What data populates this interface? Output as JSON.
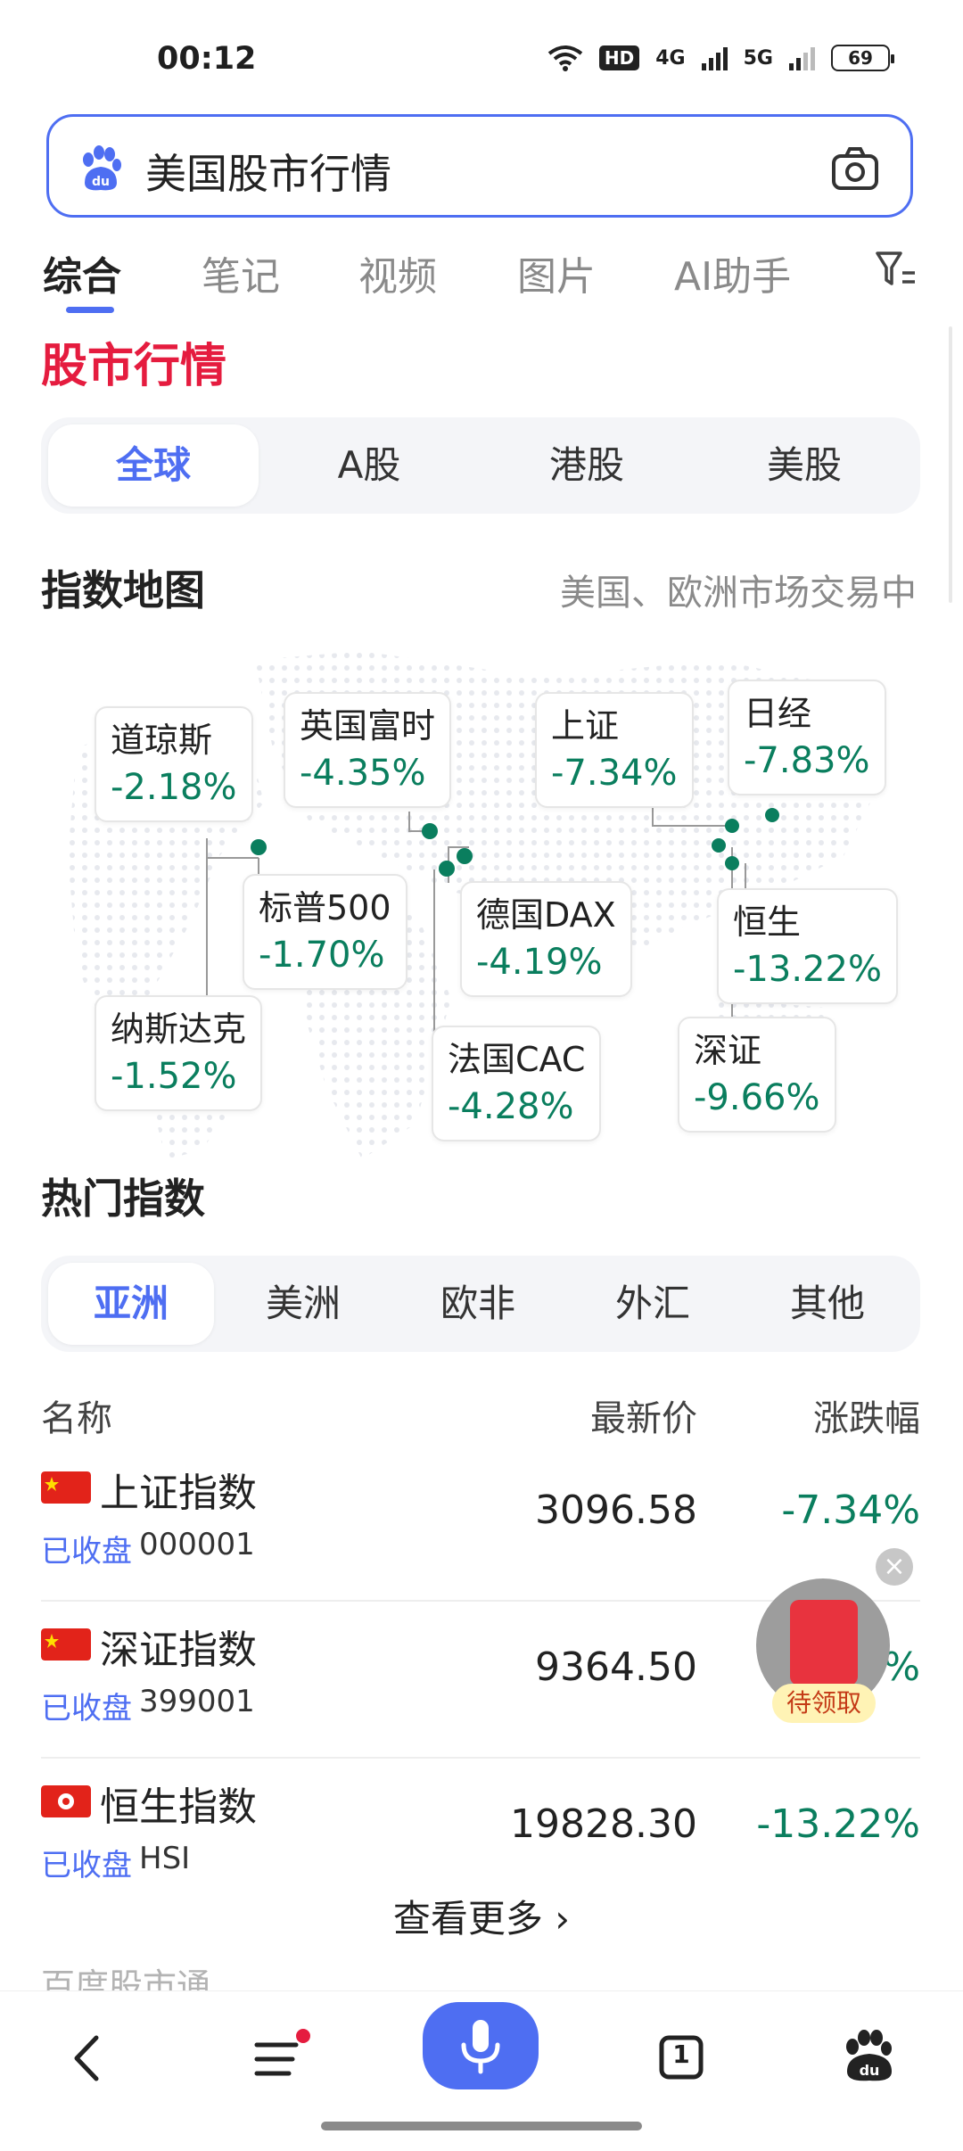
{
  "status": {
    "time": "00:12",
    "battery": "69",
    "hd": "HD",
    "net1": "4G",
    "net2": "5G"
  },
  "search": {
    "query": "美国股市行情",
    "camera_icon": "camera-icon",
    "logo_icon": "baidu-paw-icon"
  },
  "tabs": [
    {
      "label": "综合"
    },
    {
      "label": "笔记"
    },
    {
      "label": "视频"
    },
    {
      "label": "图片"
    },
    {
      "label": "AI助手"
    }
  ],
  "section_title": "股市行情",
  "market_tabs": [
    {
      "label": "全球"
    },
    {
      "label": "A股"
    },
    {
      "label": "港股"
    },
    {
      "label": "美股"
    }
  ],
  "index_map": {
    "title": "指数地图",
    "status": "美国、欧洲市场交易中",
    "indices": [
      {
        "name": "道琼斯",
        "change": "-2.18%"
      },
      {
        "name": "英国富时",
        "change": "-4.35%"
      },
      {
        "name": "上证",
        "change": "-7.34%"
      },
      {
        "name": "日经",
        "change": "-7.83%"
      },
      {
        "name": "标普500",
        "change": "-1.70%"
      },
      {
        "name": "德国DAX",
        "change": "-4.19%"
      },
      {
        "name": "恒生",
        "change": "-13.22%"
      },
      {
        "name": "纳斯达克",
        "change": "-1.52%"
      },
      {
        "name": "法国CAC",
        "change": "-4.28%"
      },
      {
        "name": "深证",
        "change": "-9.66%"
      }
    ]
  },
  "hot_indices": {
    "title": "热门指数",
    "tabs": [
      {
        "label": "亚洲"
      },
      {
        "label": "美洲"
      },
      {
        "label": "欧非"
      },
      {
        "label": "外汇"
      },
      {
        "label": "其他"
      }
    ],
    "columns": {
      "name": "名称",
      "price": "最新价",
      "change": "涨跌幅"
    },
    "rows": [
      {
        "name": "上证指数",
        "status": "已收盘",
        "code": "000001",
        "price": "3096.58",
        "change": "-7.34%"
      },
      {
        "name": "深证指数",
        "status": "已收盘",
        "code": "399001",
        "price": "9364.50",
        "change": "-9.66%"
      },
      {
        "name": "恒生指数",
        "status": "已收盘",
        "code": "HSI",
        "price": "19828.30",
        "change": "-13.22%"
      }
    ],
    "more": "查看更多 ›"
  },
  "source": "百度股市通",
  "red_packet": {
    "label": "待领取"
  },
  "bottom_nav": {
    "tab_count": "1"
  },
  "colors": {
    "accent": "#4e6ef2",
    "title_red": "#e51c3f",
    "down_green": "#0a7e5e"
  }
}
